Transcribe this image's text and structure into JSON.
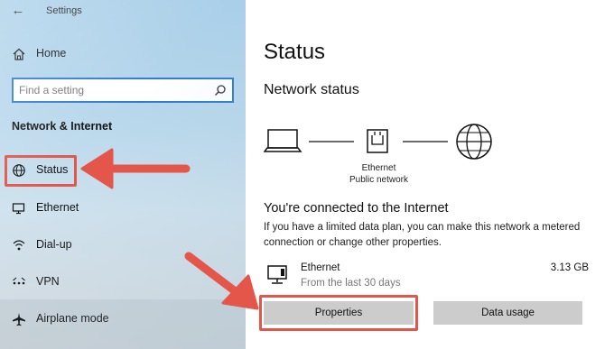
{
  "window": {
    "title": "Settings"
  },
  "sidebar": {
    "home_label": "Home",
    "search_placeholder": "Find a setting",
    "section_title": "Network & Internet",
    "items": [
      {
        "label": "Status",
        "icon": "globe-icon"
      },
      {
        "label": "Ethernet",
        "icon": "ethernet-icon"
      },
      {
        "label": "Dial-up",
        "icon": "dialup-icon"
      },
      {
        "label": "VPN",
        "icon": "vpn-icon"
      },
      {
        "label": "Airplane mode",
        "icon": "airplane-icon"
      }
    ]
  },
  "main": {
    "page_title": "Status",
    "network_status_title": "Network status",
    "diagram": {
      "adapter_name": "Ethernet",
      "network_name": "Public network"
    },
    "connected_title": "You're connected to the Internet",
    "connected_desc": "If you have a limited data plan, you can make this network a metered connection or change other properties.",
    "ethernet": {
      "name": "Ethernet",
      "period": "From the last 30 days",
      "usage": "3.13 GB"
    },
    "buttons": {
      "properties": "Properties",
      "data_usage": "Data usage"
    }
  },
  "colors": {
    "accent": "#2f7bd0",
    "annotation": "#e4554a",
    "button_bg": "#cccccc"
  }
}
